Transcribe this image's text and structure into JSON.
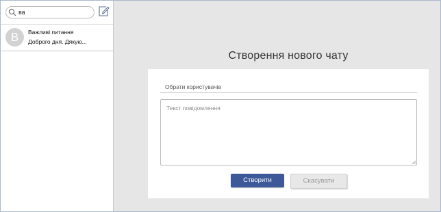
{
  "sidebar": {
    "search": {
      "value": "ва",
      "placeholder": ""
    },
    "compose_icon": "pencil-square-icon",
    "chats": [
      {
        "avatar_letter": "В",
        "name": "Важливі питання",
        "preview": "Доброго дня. Дякую..."
      }
    ]
  },
  "main": {
    "title": "Створення нового чату",
    "users_field_label": "Обрати користувачів",
    "message_placeholder": "Текст повідомлення",
    "create_button": "Створити",
    "cancel_button": "Скасувати"
  },
  "colors": {
    "primary_button": "#3d5999",
    "background": "#e6e6e6",
    "avatar": "#d2d2d2"
  }
}
